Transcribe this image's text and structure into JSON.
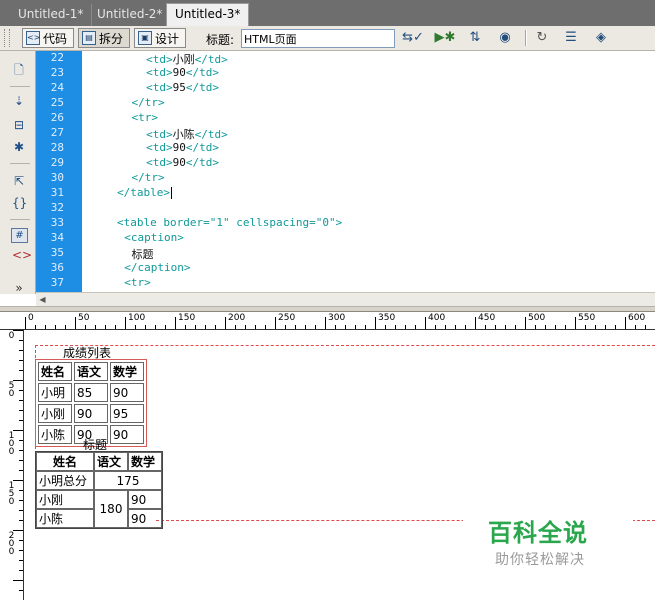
{
  "tabs": [
    {
      "label": "Untitled-1*",
      "active": false
    },
    {
      "label": "Untitled-2*",
      "active": false
    },
    {
      "label": "Untitled-3*",
      "active": true
    }
  ],
  "toolbar": {
    "code_label": "代码",
    "split_label": "拆分",
    "design_label": "设计",
    "title_label": "标题:",
    "title_value": "HTML页面",
    "icons": [
      "validate-icon",
      "preview-debug-icon",
      "file-management-icon",
      "browser-check-icon",
      "refresh-icon",
      "view-options-icon",
      "visual-aids-icon"
    ]
  },
  "left_toolbar_icons": [
    "open-documents-icon",
    "collapse-tag-icon",
    "collapse-selection-icon",
    "expand-all-icon",
    "select-parent-tag-icon",
    "balance-braces-icon",
    "line-numbers-icon",
    "highlight-invalid-icon",
    "more-icon"
  ],
  "code": {
    "line_numbers": [
      "22",
      "23",
      "24",
      "25",
      "26",
      "27",
      "28",
      "29",
      "30",
      "31",
      "32",
      "33",
      "34",
      "35",
      "36",
      "37"
    ],
    "lines": [
      {
        "indent": 8,
        "parts": [
          [
            "tag",
            "<td>"
          ],
          [
            "txt",
            "小刚"
          ],
          [
            "tag",
            "</td>"
          ]
        ]
      },
      {
        "indent": 8,
        "parts": [
          [
            "tag",
            "<td>"
          ],
          [
            "txt",
            "90"
          ],
          [
            "tag",
            "</td>"
          ]
        ]
      },
      {
        "indent": 8,
        "parts": [
          [
            "tag",
            "<td>"
          ],
          [
            "txt",
            "95"
          ],
          [
            "tag",
            "</td>"
          ]
        ]
      },
      {
        "indent": 6,
        "parts": [
          [
            "tag",
            "</tr>"
          ]
        ]
      },
      {
        "indent": 6,
        "parts": [
          [
            "tag",
            "<tr>"
          ]
        ]
      },
      {
        "indent": 8,
        "parts": [
          [
            "tag",
            "<td>"
          ],
          [
            "txt",
            "小陈"
          ],
          [
            "tag",
            "</td>"
          ]
        ]
      },
      {
        "indent": 8,
        "parts": [
          [
            "tag",
            "<td>"
          ],
          [
            "txt",
            "90"
          ],
          [
            "tag",
            "</td>"
          ]
        ]
      },
      {
        "indent": 8,
        "parts": [
          [
            "tag",
            "<td>"
          ],
          [
            "txt",
            "90"
          ],
          [
            "tag",
            "</td>"
          ]
        ]
      },
      {
        "indent": 6,
        "parts": [
          [
            "tag",
            "</tr>"
          ]
        ]
      },
      {
        "indent": 4,
        "parts": [
          [
            "tag",
            "</table>"
          ]
        ]
      },
      {
        "indent": 0,
        "parts": []
      },
      {
        "indent": 4,
        "parts": [
          [
            "tag",
            "<table border=\"1\" cellspacing=\"0\">"
          ]
        ]
      },
      {
        "indent": 5,
        "parts": [
          [
            "tag",
            "<caption>"
          ]
        ]
      },
      {
        "indent": 6,
        "parts": [
          [
            "txt",
            "标题"
          ]
        ]
      },
      {
        "indent": 5,
        "parts": [
          [
            "tag",
            "</caption>"
          ]
        ]
      },
      {
        "indent": 5,
        "parts": [
          [
            "tag",
            "<tr>"
          ]
        ]
      }
    ]
  },
  "ruler": {
    "top_marks": [
      "0",
      "50",
      "100",
      "150",
      "200",
      "250",
      "300",
      "350",
      "400",
      "450",
      "500",
      "550",
      "600"
    ],
    "left_marks": [
      "0",
      "50",
      "100",
      "150",
      "200"
    ]
  },
  "design": {
    "table1": {
      "caption": "成绩列表",
      "header": [
        "姓名",
        "语文",
        "数学"
      ],
      "rows": [
        [
          "小明",
          "85",
          "90"
        ],
        [
          "小刚",
          "90",
          "95"
        ],
        [
          "小陈",
          "90",
          "90"
        ]
      ]
    },
    "table2": {
      "caption": "标题",
      "header": [
        "姓名",
        "语文",
        "数学"
      ],
      "row1": {
        "name": "小明总分",
        "total": "175"
      },
      "row2": {
        "name": "小刚",
        "chinese": "180",
        "math": "90"
      },
      "row3": {
        "name": "小陈",
        "math": "90"
      }
    }
  },
  "watermark": {
    "main": "百科全说",
    "sub": "助你轻松解决"
  }
}
